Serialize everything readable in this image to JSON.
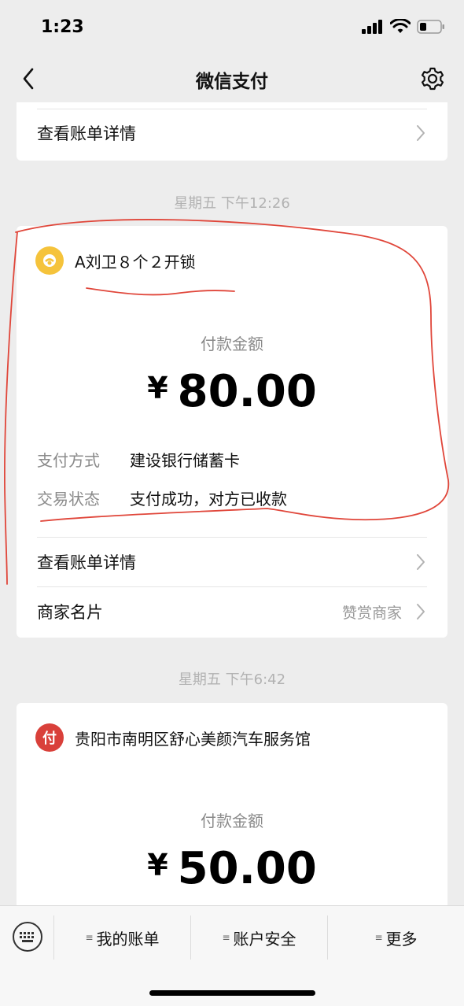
{
  "status_bar": {
    "time": "1:23"
  },
  "nav": {
    "title": "微信支付"
  },
  "top_card": {
    "detail_label": "查看账单详情"
  },
  "payments": [
    {
      "timestamp": "星期五 下午12:26",
      "merchant": "A刘卫８个２开锁",
      "amount_label": "付款金额",
      "currency": "¥",
      "amount": "80.00",
      "method_key": "支付方式",
      "method_value": "建设银行储蓄卡",
      "status_key": "交易状态",
      "status_value": "支付成功，对方已收款",
      "detail_label": "查看账单详情",
      "merchant_card_label": "商家名片",
      "merchant_card_hint": "赞赏商家",
      "logo_color": "#f5c33b"
    },
    {
      "timestamp": "星期五 下午6:42",
      "merchant": "贵阳市南明区舒心美颜汽车服务馆",
      "amount_label": "付款金额",
      "currency": "¥",
      "amount": "50.00",
      "logo_char": "付",
      "logo_color": "#d9403a"
    }
  ],
  "tabbar": {
    "items": [
      "我的账单",
      "账户安全",
      "更多"
    ]
  },
  "colors": {
    "background": "#ededed",
    "card": "#ffffff",
    "annotation": "#e0463a"
  }
}
